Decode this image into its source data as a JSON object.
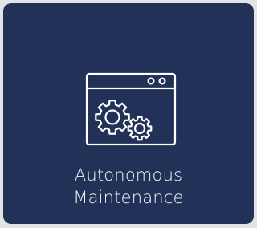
{
  "tile": {
    "label_line1": "Autonomous",
    "label_line2": "Maintenance",
    "icon": "browser-window-gears-icon",
    "background_color": "#223158",
    "foreground_color": "#ffffff"
  }
}
